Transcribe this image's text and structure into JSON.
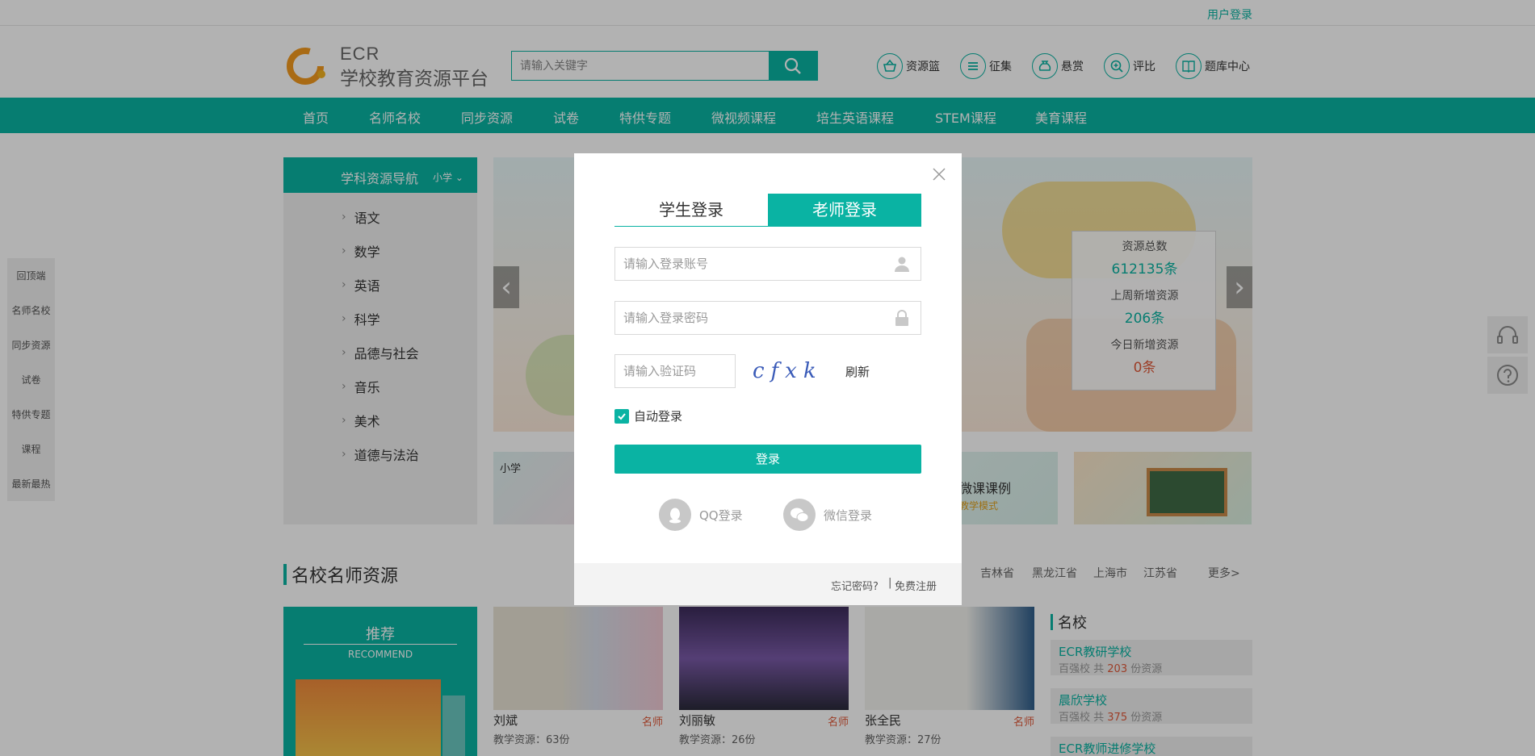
{
  "topbar": {
    "user_login": "用户登录"
  },
  "logo": {
    "ecr": "ECR",
    "name": "学校教育资源平台"
  },
  "search": {
    "placeholder": "请输入关键字"
  },
  "quick_links": [
    {
      "label": "资源篮",
      "icon": "basket-icon"
    },
    {
      "label": "征集",
      "icon": "list-icon"
    },
    {
      "label": "悬赏",
      "icon": "money-bag-icon"
    },
    {
      "label": "评比",
      "icon": "zoom-in-icon"
    },
    {
      "label": "题库中心",
      "icon": "book-icon"
    }
  ],
  "nav": [
    "首页",
    "名师名校",
    "同步资源",
    "试卷",
    "特供专题",
    "微视频课程",
    "培生英语课程",
    "STEM课程",
    "美育课程"
  ],
  "sidenav": {
    "title": "学科资源导航",
    "level": "小学",
    "subjects": [
      "语文",
      "数学",
      "英语",
      "科学",
      "品德与社会",
      "音乐",
      "美术",
      "道德与法治"
    ]
  },
  "stats": {
    "total_label": "资源总数",
    "total_value": "612135条",
    "week_label": "上周新增资源",
    "week_value": "206条",
    "today_label": "今日新增资源",
    "today_value": "0条"
  },
  "tiles": {
    "t1_label": "小学",
    "t3_label": "微课课例",
    "t3_sub": "教学模式"
  },
  "section": {
    "title": "名校名师资源"
  },
  "provinces": [
    "吉林省",
    "黑龙江省",
    "上海市",
    "江苏省"
  ],
  "provinces_more": "更多>",
  "recommend": {
    "title": "推荐",
    "sub": "RECOMMEND"
  },
  "teachers": [
    {
      "name": "刘斌",
      "tag": "名师",
      "resources": "教学资源：63份"
    },
    {
      "name": "刘丽敏",
      "tag": "名师",
      "resources": "教学资源：26份"
    },
    {
      "name": "张全民",
      "tag": "名师",
      "resources": "教学资源：27份"
    }
  ],
  "schools": {
    "title": "名校",
    "items": [
      {
        "name": "ECR教研学校",
        "prefix": "百强校 共",
        "count": "203",
        "suffix": "份资源"
      },
      {
        "name": "晨欣学校",
        "prefix": "百强校 共",
        "count": "375",
        "suffix": "份资源"
      },
      {
        "name": "ECR教师进修学校",
        "prefix": "",
        "count": "",
        "suffix": ""
      }
    ]
  },
  "leftnav": [
    "回顶端",
    "名师名校",
    "同步资源",
    "试卷",
    "特供专题",
    "课程",
    "最新最热"
  ],
  "modal": {
    "tab_student": "学生登录",
    "tab_teacher": "老师登录",
    "account_placeholder": "请输入登录账号",
    "password_placeholder": "请输入登录密码",
    "captcha_placeholder": "请输入验证码",
    "captcha_text": "cfxk",
    "refresh": "刷新",
    "auto_login": "自动登录",
    "login_button": "登录",
    "qq_login": "QQ登录",
    "wechat_login": "微信登录",
    "forgot": "忘记密码?",
    "separator": "|",
    "register": "免费注册"
  },
  "colors": {
    "accent": "#0ab3a3",
    "highlight": "#e05a3a"
  }
}
